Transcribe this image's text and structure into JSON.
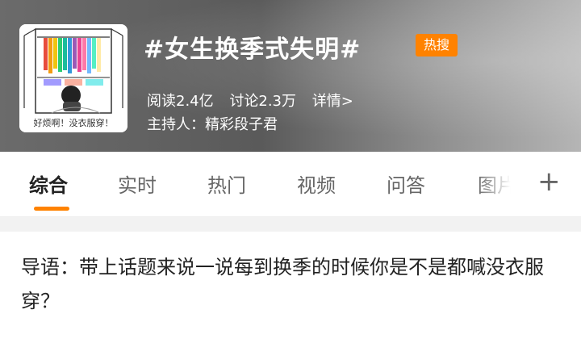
{
  "header": {
    "title": "#女生换季式失明#",
    "hot_badge": "热搜",
    "stats": {
      "reads": "阅读2.4亿",
      "discussions": "讨论2.3万",
      "details": "详情>"
    },
    "host": "主持人：精彩段子君",
    "thumbnail_caption": "好烦啊！没衣服穿！"
  },
  "tabs": [
    {
      "label": "综合"
    },
    {
      "label": "实时"
    },
    {
      "label": "热门"
    },
    {
      "label": "视频"
    },
    {
      "label": "问答"
    },
    {
      "label": "图片"
    }
  ],
  "tab_more": "+",
  "intro_text": "导语：带上话题来说一说每到换季的时候你是不是都喊没衣服穿？",
  "colors": {
    "accent": "#ff8200",
    "header_bg": "#6b6b6b"
  }
}
